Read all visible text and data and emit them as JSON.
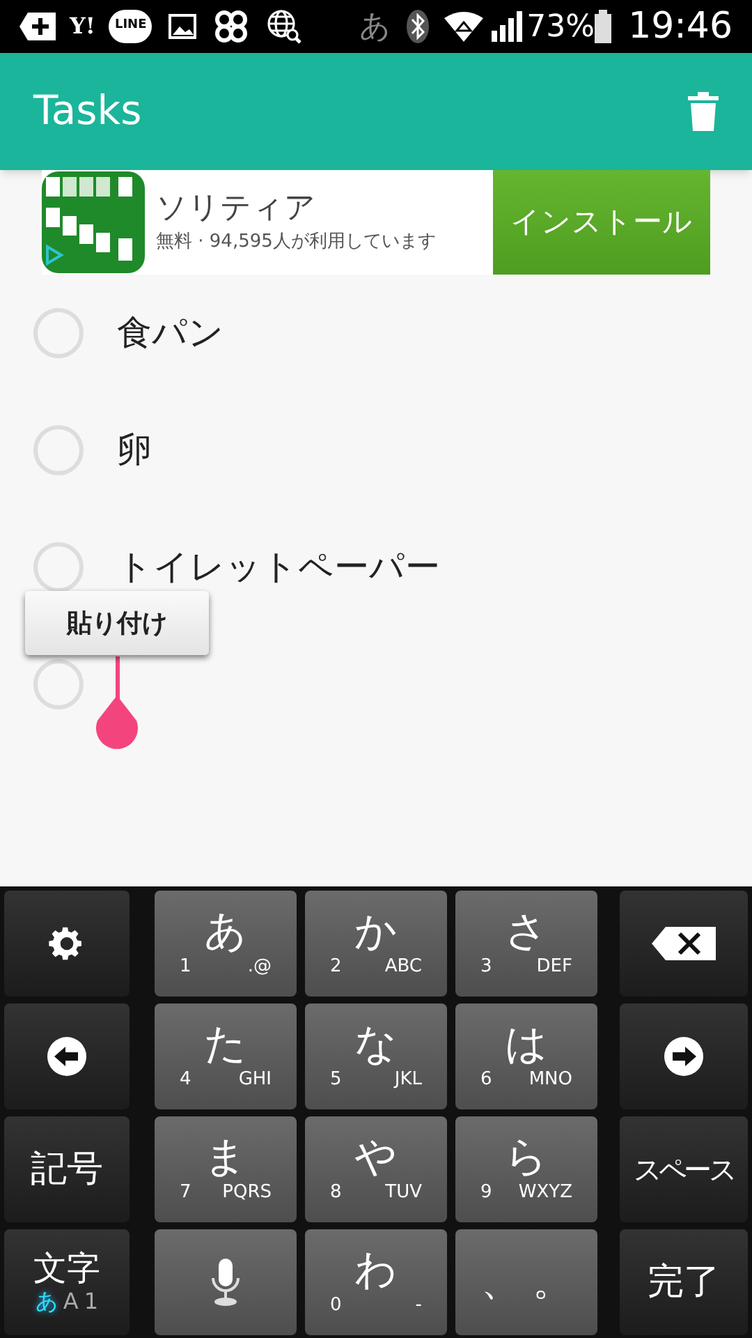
{
  "status_bar": {
    "yahoo_label": "Y!",
    "line_label": "LINE",
    "ime_indicator": "あ",
    "battery": "73%",
    "time": "19:46"
  },
  "app_bar": {
    "title": "Tasks"
  },
  "ad": {
    "title": "ソリティア",
    "subtitle": "無料 · 94,595人が利用しています",
    "button": "インストール"
  },
  "tasks": [
    {
      "text": "食パン",
      "checked": false,
      "editing": false
    },
    {
      "text": "卵",
      "checked": false,
      "editing": false
    },
    {
      "text": "トイレットペーパー",
      "checked": false,
      "editing": false
    },
    {
      "checked": false,
      "editing": true
    }
  ],
  "paste_popup": {
    "label": "貼り付け"
  },
  "keyboard": {
    "rows": [
      [
        {
          "kind": "settings"
        },
        {
          "kind": "kana",
          "main": "あ",
          "num": "1",
          "letters": ".@"
        },
        {
          "kind": "kana",
          "main": "か",
          "num": "2",
          "letters": "ABC"
        },
        {
          "kind": "kana",
          "main": "さ",
          "num": "3",
          "letters": "DEF"
        },
        {
          "kind": "backspace"
        }
      ],
      [
        {
          "kind": "left"
        },
        {
          "kind": "kana",
          "main": "た",
          "num": "4",
          "letters": "GHI"
        },
        {
          "kind": "kana",
          "main": "な",
          "num": "5",
          "letters": "JKL"
        },
        {
          "kind": "kana",
          "main": "は",
          "num": "6",
          "letters": "MNO"
        },
        {
          "kind": "right"
        }
      ],
      [
        {
          "kind": "label",
          "label": "記号"
        },
        {
          "kind": "kana",
          "main": "ま",
          "num": "7",
          "letters": "PQRS"
        },
        {
          "kind": "kana",
          "main": "や",
          "num": "8",
          "letters": "TUV"
        },
        {
          "kind": "kana",
          "main": "ら",
          "num": "9",
          "letters": "WXYZ"
        },
        {
          "kind": "label",
          "label": "スペース"
        }
      ],
      [
        {
          "kind": "mode",
          "label": "文字",
          "modes": [
            {
              "label": "あ",
              "selected": true
            },
            {
              "label": "A",
              "selected": false
            },
            {
              "label": "1",
              "selected": false
            }
          ]
        },
        {
          "kind": "mic"
        },
        {
          "kind": "kana",
          "main": "わ",
          "num": "0",
          "letters": "-"
        },
        {
          "kind": "punct",
          "label": "、 。"
        },
        {
          "kind": "label",
          "label": "完了"
        }
      ]
    ]
  }
}
